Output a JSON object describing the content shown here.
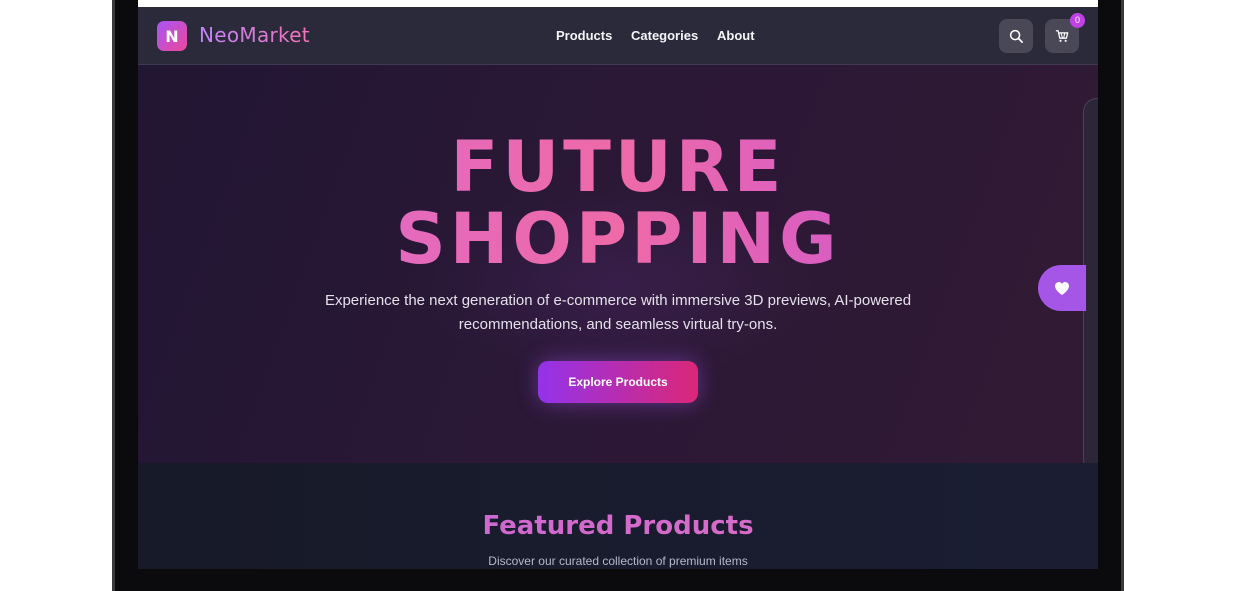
{
  "header": {
    "logo_letter": "N",
    "brand": "NeoMarket",
    "nav": [
      {
        "label": "Products"
      },
      {
        "label": "Categories"
      },
      {
        "label": "About"
      }
    ],
    "cart_count": "0",
    "icons": {
      "search": "search-icon",
      "cart": "cart-icon"
    }
  },
  "hero": {
    "title_line1": "FUTURE",
    "title_line2": "SHOPPING",
    "subtitle_line1": "Experience the next generation of e-commerce with immersive 3D previews, AI-powered",
    "subtitle_line2": "recommendations, and seamless virtual try-ons.",
    "cta_label": "Explore Products"
  },
  "side": {
    "favorite_icon": "heart-icon"
  },
  "featured": {
    "title": "Featured Products",
    "subtitle": "Discover our curated collection of premium items"
  },
  "colors": {
    "accent_purple": "#a855f7",
    "accent_pink": "#ec4899",
    "nav_bg": "#2b2a3a",
    "hero_bg": "#2b1836"
  }
}
